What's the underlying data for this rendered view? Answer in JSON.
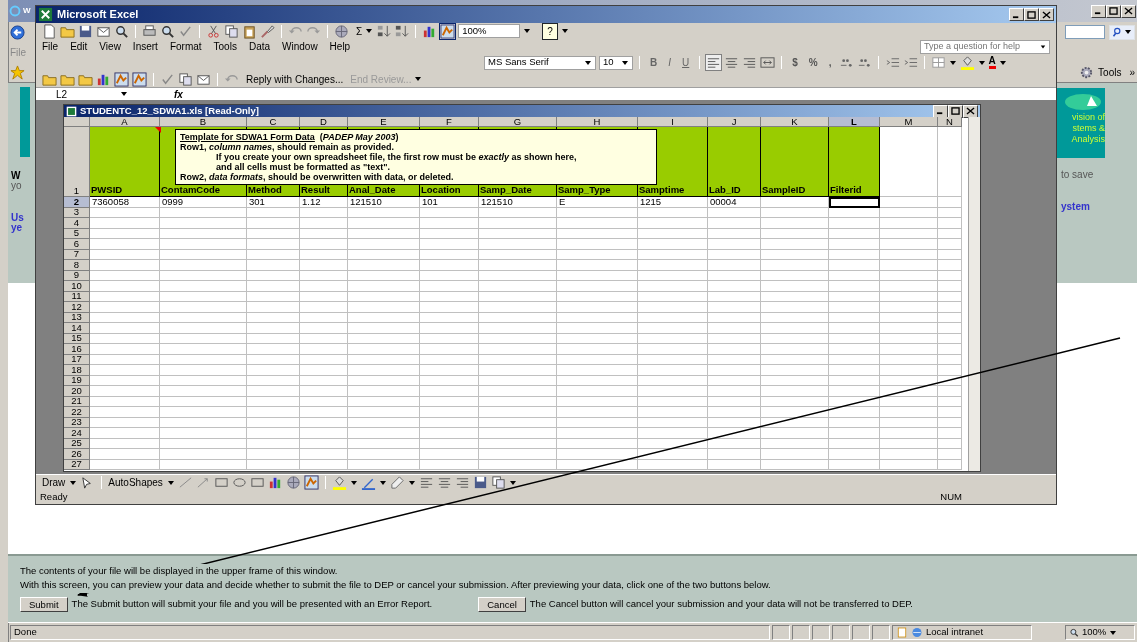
{
  "browser": {
    "title": "W",
    "menu_partial": "File",
    "logo_lines": [
      "vision of",
      "stems &",
      "Analysis"
    ],
    "left_texts": [
      {
        "text": "W",
        "kind": "heading"
      },
      {
        "text": "yo",
        "kind": "muted"
      },
      {
        "text": "Us",
        "kind": "link"
      },
      {
        "text": "ye",
        "kind": "link"
      }
    ],
    "right_texts": [
      {
        "text": "to save",
        "kind": "muted"
      },
      {
        "text": "ystem",
        "kind": "link"
      }
    ],
    "tools_button": "Tools",
    "chevron": "»"
  },
  "excel": {
    "title": "Microsoft Excel",
    "sum": "Σ",
    "zoom": "100%",
    "help_button": "?",
    "menu": [
      "File",
      "Edit",
      "View",
      "Insert",
      "Format",
      "Tools",
      "Data",
      "Window",
      "Help"
    ],
    "help_placeholder": "Type a question for help",
    "font": "MS Sans Serif",
    "font_size": "10",
    "format_buttons": [
      "B",
      "I",
      "U"
    ],
    "number_buttons": [
      "$",
      "%",
      ","
    ],
    "font_color_button": "A",
    "reviewing": [
      {
        "label": "Reply with Changes...",
        "disabled": false
      },
      {
        "label": "End Review...",
        "disabled": true
      }
    ],
    "name_box": "L2",
    "fx": "fx",
    "draw": "Draw",
    "autoshapes": "AutoShapes",
    "status": "Ready",
    "num": "NUM"
  },
  "workbook": {
    "title": "STUDENTC_12_SDWA1.xls  [Read-Only]",
    "columns": [
      {
        "label": "A",
        "selected": false
      },
      {
        "label": "B",
        "selected": false
      },
      {
        "label": "C",
        "selected": false
      },
      {
        "label": "D",
        "selected": false
      },
      {
        "label": "E",
        "selected": false
      },
      {
        "label": "F",
        "selected": false
      },
      {
        "label": "G",
        "selected": false
      },
      {
        "label": "H",
        "selected": false
      },
      {
        "label": "I",
        "selected": false
      },
      {
        "label": "J",
        "selected": false
      },
      {
        "label": "K",
        "selected": false
      },
      {
        "label": "L",
        "selected": true
      },
      {
        "label": "M",
        "selected": false
      },
      {
        "label": "N",
        "selected": false
      }
    ],
    "rows": [
      {
        "number": "1",
        "selected": false,
        "kind": "header",
        "cells": [
          "PWSID",
          "ContamCode",
          "Method",
          "Result",
          "Anal_Date",
          "Location",
          "Samp_Date",
          "Samp_Type",
          "Samptime",
          "Lab_ID",
          "SampleID",
          "Filterid"
        ]
      },
      {
        "number": "2",
        "selected": true,
        "kind": "data",
        "cells": [
          "7360058",
          "0999",
          "301",
          "1.12",
          "121510",
          "101",
          "121510",
          "E",
          "1215",
          "00004"
        ]
      },
      {
        "number": "3",
        "selected": false
      },
      {
        "number": "4",
        "selected": false
      },
      {
        "number": "5",
        "selected": false
      },
      {
        "number": "6",
        "selected": false
      },
      {
        "number": "7",
        "selected": false
      },
      {
        "number": "8",
        "selected": false
      },
      {
        "number": "9",
        "selected": false
      },
      {
        "number": "10",
        "selected": false
      },
      {
        "number": "11",
        "selected": false
      },
      {
        "number": "12",
        "selected": false
      },
      {
        "number": "13",
        "selected": false
      },
      {
        "number": "14",
        "selected": false
      },
      {
        "number": "15",
        "selected": false
      },
      {
        "number": "16",
        "selected": false
      },
      {
        "number": "17",
        "selected": false
      },
      {
        "number": "18",
        "selected": false
      },
      {
        "number": "19",
        "selected": false
      },
      {
        "number": "20",
        "selected": false
      },
      {
        "number": "21",
        "selected": false
      },
      {
        "number": "22",
        "selected": false
      },
      {
        "number": "23",
        "selected": false
      },
      {
        "number": "24",
        "selected": false
      },
      {
        "number": "25",
        "selected": false
      },
      {
        "number": "26",
        "selected": false
      },
      {
        "number": "27",
        "selected": false
      }
    ],
    "comment": [
      {
        "kind": "title",
        "text": "Template for SDWA1 Form Data"
      },
      {
        "kind": "title-note",
        "text": "(*PADEP May 2003*)"
      },
      {
        "kind": "line",
        "text": "Row1, *column names*, should remain as provided."
      },
      {
        "kind": "indented",
        "text": "If you create  your own spreadsheet file, the first row must be *exactly* as shown here,"
      },
      {
        "kind": "indented",
        "text": "and all cells must be formatted as \"text\"."
      },
      {
        "kind": "line",
        "text": "Row2, *data formats*, should be overwritten with data, or deleted."
      }
    ]
  },
  "bottom_frame": {
    "lines": [
      "The contents of your file will be displayed in the upper frame of this window.",
      "With this screen, you can preview your data and decide whether to submit the file to DEP or cancel your submission. After previewing your data, click one of the two buttons below."
    ],
    "actions": [
      {
        "button": "Submit",
        "note": "The Submit button will submit your file and you will be presented with an Error Report."
      },
      {
        "button": "Cancel",
        "note": "The Cancel button will cancel your submission and your data will not be transferred to DEP."
      }
    ]
  },
  "status_bar": {
    "text": "Done",
    "zone": "Local intranet",
    "zoom": "100%"
  }
}
